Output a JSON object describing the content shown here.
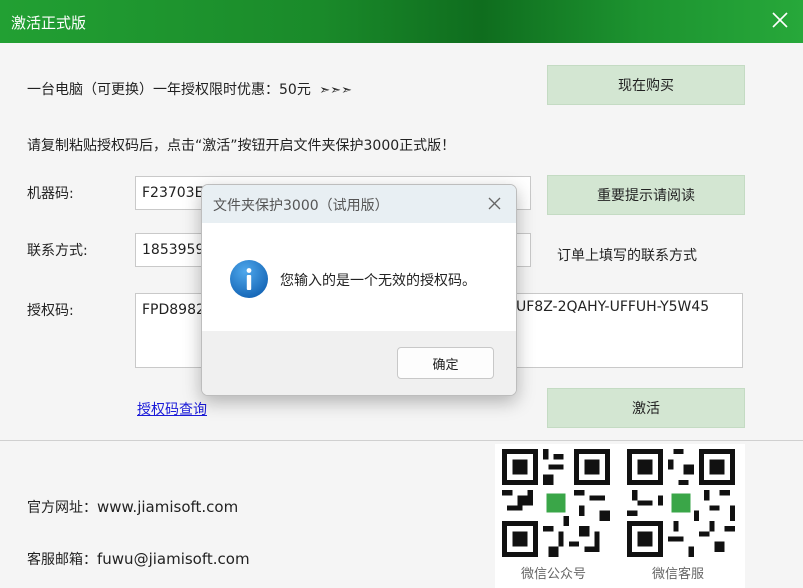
{
  "window": {
    "title": "激活正式版"
  },
  "offer": {
    "text": "一台电脑（可更换）一年授权限时优惠：50元",
    "arrows": "➣➣➣",
    "buy_label": "现在购买"
  },
  "instruction": "请复制粘贴授权码后，点击“激活”按钮开启文件夹保护3000正式版！",
  "machine_code": {
    "label": "机器码:",
    "value": "F23703E",
    "hint_button": "重要提示请阅读"
  },
  "contact": {
    "label": "联系方式:",
    "value": "1853959",
    "hint": "订单上填写的联系方式"
  },
  "license": {
    "label": "授权码:",
    "value_left": "FPD8982",
    "value_right": "UF8Z-2QAHY-UFFUH-Y5W45"
  },
  "query_link": "授权码查询",
  "activate_label": "激活",
  "footer": {
    "website_label": "官方网址：",
    "website": "www.jiamisoft.com",
    "email_label": "客服邮箱：",
    "email": "fuwu@jiamisoft.com",
    "qr_captions": [
      "微信公众号",
      "微信客服"
    ]
  },
  "dialog": {
    "title": "文件夹保护3000（试用版）",
    "message": "您输入的是一个无效的授权码。",
    "ok_label": "确定",
    "icon": "info-icon"
  },
  "colors": {
    "titlebar": "#1a8a2a",
    "button_green": "#d3e6d2",
    "link": "#1a1ad8",
    "info_blue": "#1e7fd0"
  }
}
